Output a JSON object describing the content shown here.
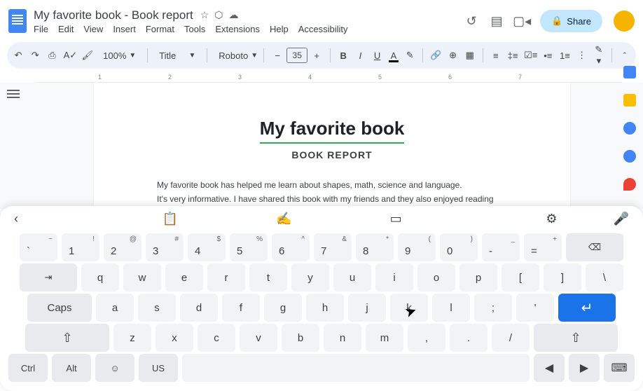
{
  "header": {
    "title": "My favorite book - Book report",
    "menus": [
      "File",
      "Edit",
      "View",
      "Insert",
      "Format",
      "Tools",
      "Extensions",
      "Help",
      "Accessibility"
    ],
    "share": "Share"
  },
  "toolbar": {
    "zoom": "100%",
    "style": "Title",
    "font": "Roboto",
    "size": "35"
  },
  "ruler": [
    "1",
    "2",
    "3",
    "4",
    "5",
    "6",
    "7"
  ],
  "document": {
    "h1": "My favorite book",
    "h2": "BOOK REPORT",
    "p1": "My favorite book has helped me learn about shapes, math, science and language.",
    "p2": "It's very informative. I have shared this book with my friends and they also enjoyed reading"
  },
  "keyboard": {
    "row1": [
      {
        "m": "`",
        "s": "~"
      },
      {
        "m": "1",
        "s": "!"
      },
      {
        "m": "2",
        "s": "@"
      },
      {
        "m": "3",
        "s": "#"
      },
      {
        "m": "4",
        "s": "$"
      },
      {
        "m": "5",
        "s": "%"
      },
      {
        "m": "6",
        "s": "^"
      },
      {
        "m": "7",
        "s": "&"
      },
      {
        "m": "8",
        "s": "*"
      },
      {
        "m": "9",
        "s": "("
      },
      {
        "m": "0",
        "s": ")"
      },
      {
        "m": "-",
        "s": "_"
      },
      {
        "m": "=",
        "s": "+"
      }
    ],
    "row2": [
      "q",
      "w",
      "e",
      "r",
      "t",
      "y",
      "u",
      "i",
      "o",
      "p",
      "[",
      "]",
      "\\"
    ],
    "caps": "Caps",
    "row3": [
      "a",
      "s",
      "d",
      "f",
      "g",
      "h",
      "j",
      "k",
      "l",
      ";",
      "'"
    ],
    "row4": [
      "z",
      "x",
      "c",
      "v",
      "b",
      "n",
      "m",
      ",",
      ".",
      "/"
    ],
    "ctrl": "Ctrl",
    "alt": "Alt",
    "lang": "US"
  }
}
